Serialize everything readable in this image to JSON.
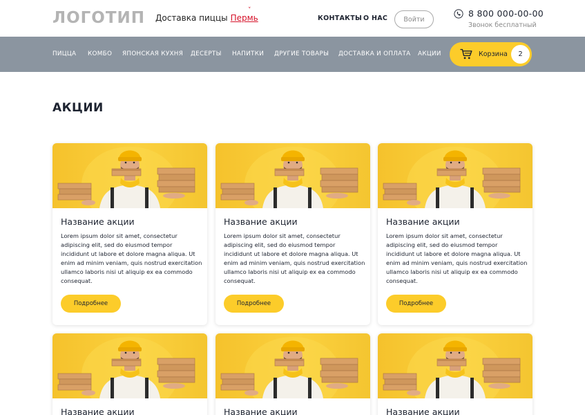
{
  "header": {
    "logo": "ЛОГОТИП",
    "delivery_label": "Доставка пиццы",
    "city": "Пермь",
    "caret": "˅",
    "links": [
      "КОНТАКТЫ",
      "О НАС"
    ],
    "login_label": "Войти",
    "phone": "8 800 000-00-00",
    "phone_note": "Звонок бесплатный"
  },
  "nav": {
    "items": [
      "ПИЦЦА",
      "КОМБО",
      "ЯПОНСКАЯ КУХНЯ",
      "ДЕСЕРТЫ",
      "НАПИТКИ",
      "ДРУГИЕ ТОВАРЫ",
      "ДОСТАВКА И ОПЛАТА",
      "АКЦИИ"
    ],
    "cart_label": "Корзина",
    "cart_count": "2"
  },
  "page": {
    "title": "АКЦИИ"
  },
  "cards": [
    {
      "title": "Название акции",
      "text": "Lorem ipsum dolor sit amet, consectetur adipiscing elit, sed do eiusmod tempor incididunt ut labore et dolore magna aliqua. Ut enim ad minim veniam, quis nostrud exercitation ullamco laboris nisi ut aliquip ex ea commodo consequat.",
      "button": "Подробнее"
    },
    {
      "title": "Название акции",
      "text": "Lorem ipsum dolor sit amet, consectetur adipiscing elit, sed do eiusmod tempor incididunt ut labore et dolore magna aliqua. Ut enim ad minim veniam, quis nostrud exercitation ullamco laboris nisi ut aliquip ex ea commodo consequat.",
      "button": "Подробнее"
    },
    {
      "title": "Название акции",
      "text": "Lorem ipsum dolor sit amet, consectetur adipiscing elit, sed do eiusmod tempor incididunt ut labore et dolore magna aliqua. Ut enim ad minim veniam, quis nostrud exercitation ullamco laboris nisi ut aliquip ex ea commodo consequat.",
      "button": "Подробнее"
    },
    {
      "title": "Название акции"
    },
    {
      "title": "Название акции"
    },
    {
      "title": "Название акции"
    }
  ],
  "colors": {
    "accent": "#fccc2a",
    "nav_bg": "#8b95a0",
    "city": "#d6132a",
    "text": "#1d2330"
  },
  "icons": [
    "phone-icon",
    "cart-icon",
    "chevron-down-icon"
  ]
}
